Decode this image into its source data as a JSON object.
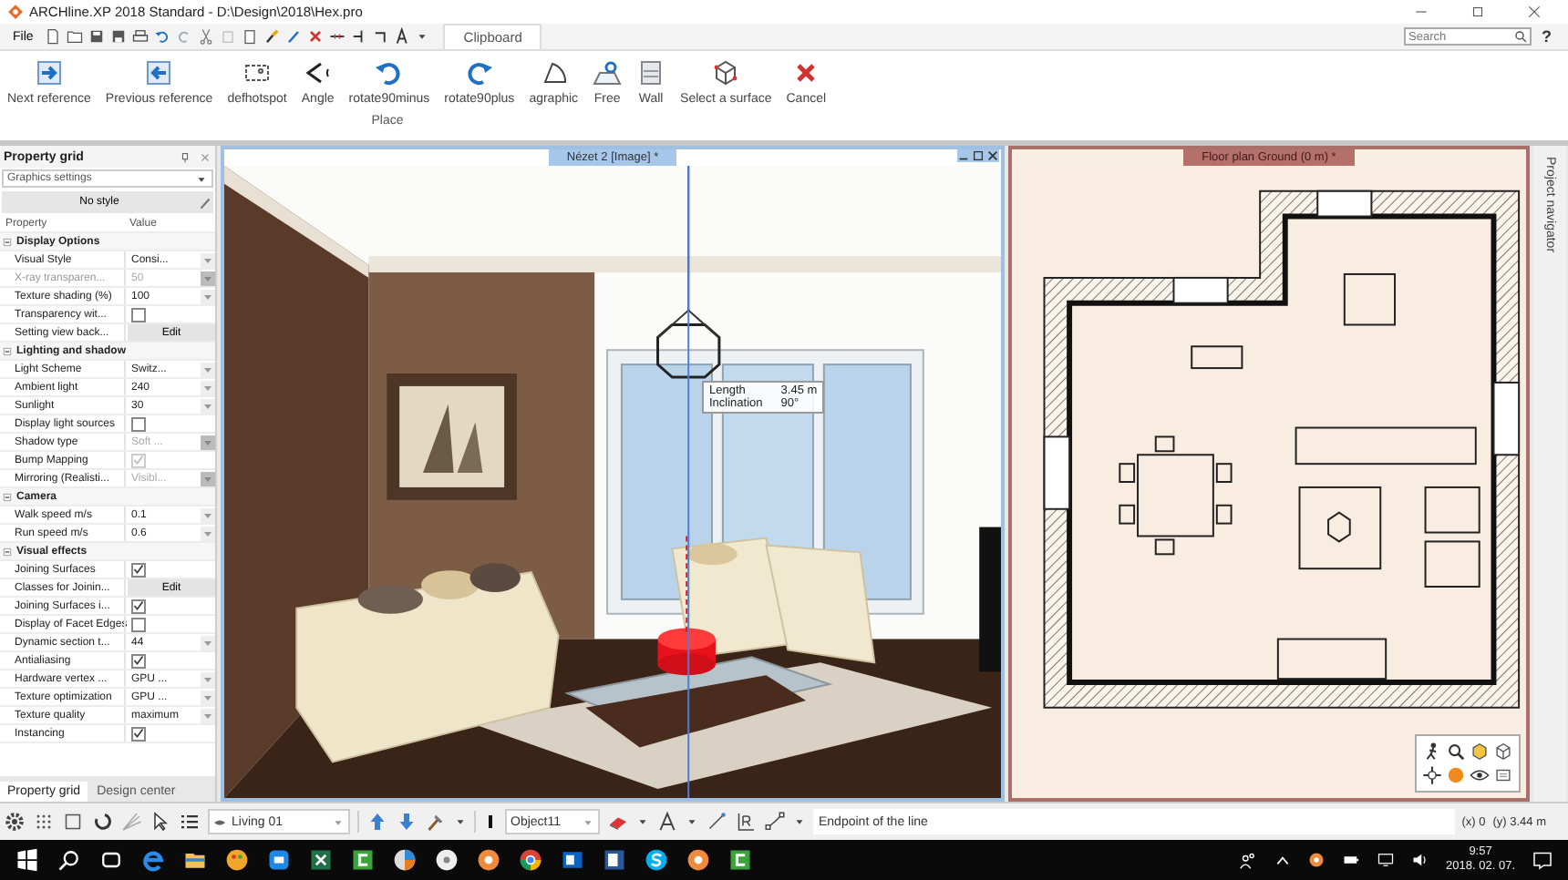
{
  "window": {
    "title": "ARCHline.XP 2018 Standard - D:\\Design\\2018\\Hex.pro"
  },
  "menu": {
    "file": "File"
  },
  "ribbon_tabs": [
    {
      "label": "Clipboard",
      "selected": true
    }
  ],
  "search": {
    "placeholder": "Search"
  },
  "help": "?",
  "ribbon": {
    "group": "Place",
    "buttons": [
      {
        "label": "Next reference"
      },
      {
        "label": "Previous reference"
      },
      {
        "label": "defhotspot"
      },
      {
        "label": "Angle"
      },
      {
        "label": "rotate90minus"
      },
      {
        "label": "rotate90plus"
      },
      {
        "label": "agraphic"
      },
      {
        "label": "Free"
      },
      {
        "label": "Wall"
      },
      {
        "label": "Select a surface"
      },
      {
        "label": "Cancel"
      }
    ]
  },
  "property_grid": {
    "title": "Property grid",
    "preset": "Graphics settings",
    "style": "No style",
    "columns": [
      "Property",
      "Value"
    ],
    "rows": [
      {
        "kind": "category",
        "label": "Display Options",
        "expanded": true
      },
      {
        "kind": "dropdown",
        "label": "Visual Style",
        "value": "Consi...",
        "disabled": false
      },
      {
        "kind": "dropdown",
        "label": "X-ray transparen...",
        "value": "50",
        "disabled": true
      },
      {
        "kind": "dropdown",
        "label": "Texture shading (%)",
        "value": "100",
        "disabled": false
      },
      {
        "kind": "check",
        "label": "Transparency wit...",
        "checked": false,
        "disabled": false
      },
      {
        "kind": "button",
        "label": "Setting view back...",
        "value": "Edit"
      },
      {
        "kind": "category",
        "label": "Lighting and shadow",
        "expanded": true
      },
      {
        "kind": "dropdown",
        "label": "Light Scheme",
        "value": "Switz...",
        "disabled": false
      },
      {
        "kind": "dropdown",
        "label": "Ambient light",
        "value": "240",
        "disabled": false
      },
      {
        "kind": "dropdown",
        "label": "Sunlight",
        "value": "30",
        "disabled": false
      },
      {
        "kind": "check",
        "label": "Display light sources",
        "checked": false,
        "disabled": false
      },
      {
        "kind": "dropdown",
        "label": "Shadow type",
        "value": "Soft ...",
        "disabled": true
      },
      {
        "kind": "check",
        "label": "Bump Mapping",
        "checked": true,
        "disabled": true
      },
      {
        "kind": "dropdown",
        "label": "Mirroring (Realisti...",
        "value": "Visibl...",
        "disabled": true
      },
      {
        "kind": "category",
        "label": "Camera",
        "expanded": true
      },
      {
        "kind": "dropdown",
        "label": "Walk speed m/s",
        "value": "0.1",
        "disabled": false
      },
      {
        "kind": "dropdown",
        "label": "Run speed m/s",
        "value": "0.6",
        "disabled": false
      },
      {
        "kind": "category",
        "label": "Visual effects",
        "expanded": true
      },
      {
        "kind": "check",
        "label": "Joining Surfaces",
        "checked": true,
        "disabled": false
      },
      {
        "kind": "button",
        "label": "Classes for Joinin...",
        "value": "Edit"
      },
      {
        "kind": "check",
        "label": "Joining Surfaces i...",
        "checked": true,
        "disabled": false
      },
      {
        "kind": "check",
        "label": "Display of Facet Edges",
        "checked": false,
        "disabled": false
      },
      {
        "kind": "dropdown",
        "label": "Dynamic section t...",
        "value": "44",
        "disabled": false
      },
      {
        "kind": "check",
        "label": "Antialiasing",
        "checked": true,
        "disabled": false
      },
      {
        "kind": "dropdown",
        "label": "Hardware vertex ...",
        "value": "GPU ...",
        "disabled": false
      },
      {
        "kind": "dropdown",
        "label": "Texture optimization",
        "value": "GPU ...",
        "disabled": false
      },
      {
        "kind": "dropdown",
        "label": "Texture quality",
        "value": "maximum",
        "disabled": false
      },
      {
        "kind": "check",
        "label": "Instancing",
        "checked": true,
        "disabled": false
      }
    ],
    "tabs": [
      {
        "label": "Property grid",
        "selected": true
      },
      {
        "label": "Design center",
        "selected": false
      }
    ]
  },
  "views": [
    {
      "kind": "render",
      "title": "Nézet 2 [Image] *",
      "active": true
    },
    {
      "kind": "plan",
      "title": "Floor plan Ground (0 m) *",
      "active": false
    }
  ],
  "measure": [
    {
      "label": "Length",
      "value": "3.45 m"
    },
    {
      "label": "Inclination",
      "value": "90°"
    }
  ],
  "side_tab": "Project navigator",
  "bottom_bar": {
    "layer": "Living 01",
    "object": "Object11",
    "status": "Endpoint of the line",
    "x": "(x) 0",
    "y": "(y) 3.44 m"
  },
  "taskbar": {
    "time": "9:57",
    "date": "2018. 02. 07."
  }
}
